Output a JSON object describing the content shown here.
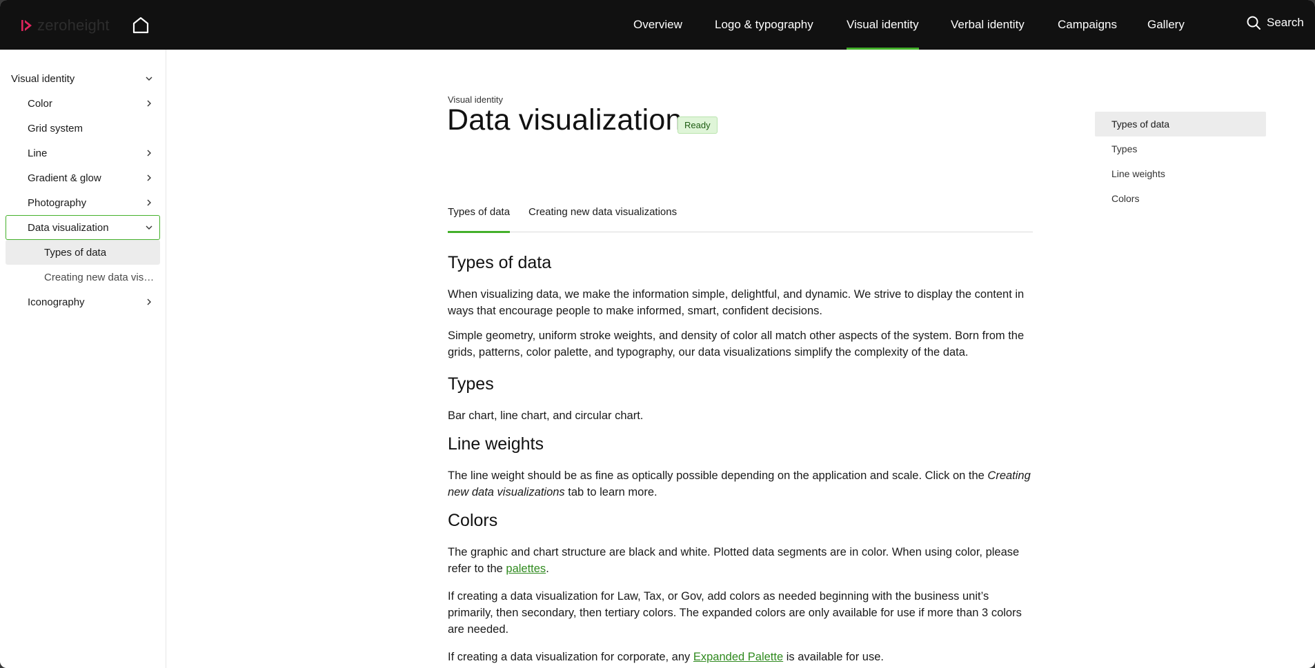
{
  "header": {
    "logo_text": "zeroheight",
    "brand_accent": "#e0245e",
    "nav": [
      {
        "label": "Overview"
      },
      {
        "label": "Logo & typography"
      },
      {
        "label": "Visual identity",
        "active": true
      },
      {
        "label": "Verbal identity"
      },
      {
        "label": "Campaigns"
      },
      {
        "label": "Gallery"
      }
    ],
    "search_label": "Search"
  },
  "sidebar": {
    "items": [
      {
        "label": "Visual identity",
        "icon": "chevron-down-icon"
      },
      {
        "label": "Color",
        "icon": "chevron-right-icon"
      },
      {
        "label": "Grid system"
      },
      {
        "label": "Line",
        "icon": "chevron-right-icon"
      },
      {
        "label": "Gradient & glow",
        "icon": "chevron-right-icon"
      },
      {
        "label": "Photography",
        "icon": "chevron-right-icon"
      },
      {
        "label": "Data visualization",
        "icon": "chevron-down-icon",
        "selected": true
      },
      {
        "label": "Types of data",
        "active": true
      },
      {
        "label": "Creating new data visualizations"
      },
      {
        "label": "Iconography",
        "icon": "chevron-right-icon"
      }
    ]
  },
  "page": {
    "eyebrow": "Visual identity",
    "title": "Data visualization",
    "status": "Ready",
    "tabs": [
      {
        "label": "Types of data",
        "active": true
      },
      {
        "label": "Creating new data visualizations"
      }
    ]
  },
  "content": {
    "types_of_data": {
      "heading": "Types of data",
      "p1": "When visualizing data, we make the information simple, delightful, and dynamic. We strive to display the content in ways that encourage people to make informed, smart, confident decisions.",
      "p2": "Simple geometry, uniform stroke weights, and density of color all match other aspects of the system. Born from the grids, patterns, color palette, and typography, our data visualizations simplify the complexity of the data."
    },
    "types": {
      "heading": "Types",
      "p1": "Bar chart, line chart, and circular chart."
    },
    "line_weights": {
      "heading": "Line weights",
      "p1_start": "The line weight should be as fine as optically possible depending on the application and scale. Click on the ",
      "p1_em": "Creating new data visualizations",
      "p1_end": " tab to learn more."
    },
    "colors": {
      "heading": "Colors",
      "p1_start": "The graphic and chart structure are black and white. Plotted data segments are in color. When using color, please refer to the ",
      "p1_link": "palettes",
      "p1_end": ".",
      "p2": "If creating a data visualization for Law, Tax, or Gov, add colors as needed beginning with the business unit’s primarily, then secondary, then tertiary colors. The expanded colors are only available for use if more than 3 colors are needed.",
      "p3_start": "If creating a data visualization for corporate, any ",
      "p3_link": "Expanded Palette",
      "p3_end": " is available for use."
    }
  },
  "toc": {
    "items": [
      {
        "label": "Types of data",
        "active": true
      },
      {
        "label": "Types"
      },
      {
        "label": "Line weights"
      },
      {
        "label": "Colors"
      }
    ]
  },
  "colors": {
    "accent_green": "#43b02a",
    "link_green": "#2f8a1e",
    "topbar": "#111111",
    "badge_bg": "#dff5d8"
  }
}
